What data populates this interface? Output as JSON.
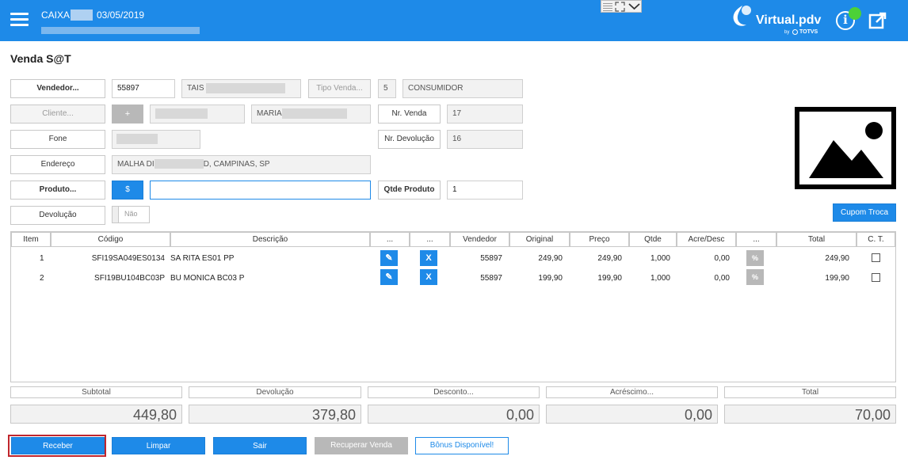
{
  "header": {
    "caixa_label": "CAIXA",
    "date": "03/05/2019",
    "logo_text": "Virtual.pdv",
    "logo_by": "by",
    "logo_totvs": "TOTVS",
    "info_label": "i"
  },
  "page_title": "Venda S@T",
  "form": {
    "vendedor_label": "Vendedor...",
    "vendedor_code": "55897",
    "vendedor_name": "TAIS",
    "tipo_venda_label": "Tipo Venda...",
    "tipo_venda_code": "5",
    "tipo_venda_name": "CONSUMIDOR",
    "cliente_label": "Cliente...",
    "cliente_add": "+",
    "cliente_name": "MARIA",
    "nr_venda_label": "Nr. Venda",
    "nr_venda_value": "17",
    "fone_label": "Fone",
    "nr_devolucao_label": "Nr. Devolução",
    "nr_devolucao_value": "16",
    "endereco_label": "Endereço",
    "endereco_prefix": "MALHA DI",
    "endereco_suffix": "D, CAMPINAS, SP",
    "produto_label": "Produto...",
    "produto_dollar": "$",
    "produto_value": "",
    "qtde_label": "Qtde Produto",
    "qtde_value": "1",
    "devolucao_label": "Devolução",
    "devolucao_toggle": "Não",
    "cupom_troca": "Cupom Troca"
  },
  "table": {
    "headers": [
      "Item",
      "Código",
      "Descrição",
      "...",
      "...",
      "Vendedor",
      "Original",
      "Preço",
      "Qtde",
      "Acre/Desc",
      "...",
      "Total",
      "C. T."
    ],
    "rows": [
      {
        "item": "1",
        "codigo": "SFI19SA049ES0134",
        "descricao": "SA RITA ES01 PP",
        "edit": "✎",
        "del": "X",
        "vendedor": "55897",
        "original": "249,90",
        "preco": "249,90",
        "qtde": "1,000",
        "acre": "0,00",
        "pct": "%",
        "total": "249,90"
      },
      {
        "item": "2",
        "codigo": "SFI19BU104BC03P",
        "descricao": "BU MONICA BC03 P",
        "edit": "✎",
        "del": "X",
        "vendedor": "55897",
        "original": "199,90",
        "preco": "199,90",
        "qtde": "1,000",
        "acre": "0,00",
        "pct": "%",
        "total": "199,90"
      }
    ]
  },
  "totals": {
    "subtotal_label": "Subtotal",
    "subtotal": "449,80",
    "devolucao_label": "Devolução",
    "devolucao": "379,80",
    "desconto_label": "Desconto...",
    "desconto": "0,00",
    "acrescimo_label": "Acréscimo...",
    "acrescimo": "0,00",
    "total_label": "Total",
    "total": "70,00"
  },
  "buttons": {
    "receber": "Receber",
    "limpar": "Limpar",
    "sair": "Sair",
    "recuperar": "Recuperar Venda",
    "bonus": "Bônus Disponível!"
  },
  "colors": {
    "accent": "#1e8ae8",
    "status_dot": "#4cd137",
    "focus_outline": "#c0262d"
  },
  "icons": [
    "menu-icon",
    "grid-icon",
    "expand-icon",
    "chevron-down-icon",
    "info-icon",
    "external-window-icon",
    "image-placeholder-icon",
    "pencil-icon",
    "close-icon",
    "percent-icon"
  ]
}
